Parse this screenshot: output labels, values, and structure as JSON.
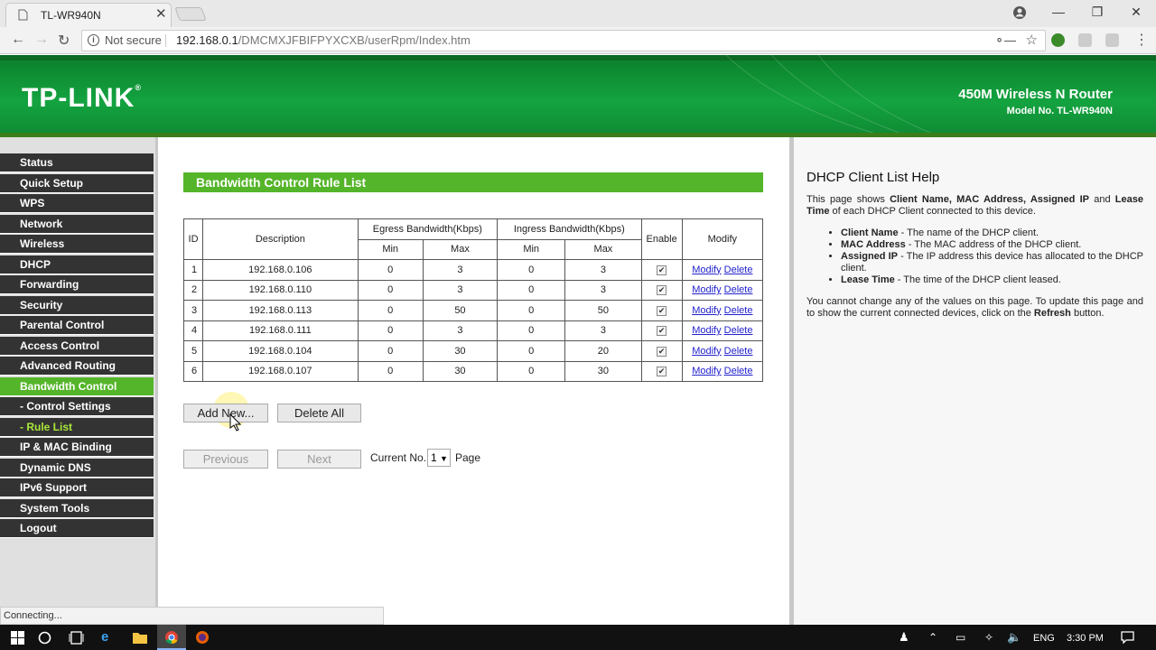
{
  "browser": {
    "tab_title": "TL-WR940N",
    "close_tab": "✕",
    "not_secure": "Not secure",
    "url_host": "192.168.0.1",
    "url_path": "/DMCMXJFBIFPYXCXB/userRpm/Index.htm",
    "status": "Connecting..."
  },
  "header": {
    "logo": "TP-LINK",
    "product": "450M Wireless N Router",
    "model": "Model No. TL-WR940N"
  },
  "sidebar": {
    "items": [
      {
        "label": "Status"
      },
      {
        "label": "Quick Setup"
      },
      {
        "label": "WPS"
      },
      {
        "label": "Network"
      },
      {
        "label": "Wireless"
      },
      {
        "label": "DHCP"
      },
      {
        "label": "Forwarding"
      },
      {
        "label": "Security"
      },
      {
        "label": "Parental Control"
      },
      {
        "label": "Access Control"
      },
      {
        "label": "Advanced Routing"
      },
      {
        "label": "Bandwidth Control"
      },
      {
        "label": "- Control Settings"
      },
      {
        "label": "- Rule List"
      },
      {
        "label": "IP & MAC Binding"
      },
      {
        "label": "Dynamic DNS"
      },
      {
        "label": "IPv6 Support"
      },
      {
        "label": "System Tools"
      },
      {
        "label": "Logout"
      }
    ]
  },
  "main": {
    "title": "Bandwidth Control Rule List",
    "headers": {
      "id": "ID",
      "description": "Description",
      "egress": "Egress Bandwidth(Kbps)",
      "ingress": "Ingress Bandwidth(Kbps)",
      "enable": "Enable",
      "modify": "Modify",
      "min": "Min",
      "max": "Max"
    },
    "rows": [
      {
        "id": "1",
        "desc": "192.168.0.106",
        "emin": "0",
        "emax": "3",
        "imin": "0",
        "imax": "3"
      },
      {
        "id": "2",
        "desc": "192.168.0.110",
        "emin": "0",
        "emax": "3",
        "imin": "0",
        "imax": "3"
      },
      {
        "id": "3",
        "desc": "192.168.0.113",
        "emin": "0",
        "emax": "50",
        "imin": "0",
        "imax": "50"
      },
      {
        "id": "4",
        "desc": "192.168.0.111",
        "emin": "0",
        "emax": "3",
        "imin": "0",
        "imax": "3"
      },
      {
        "id": "5",
        "desc": "192.168.0.104",
        "emin": "0",
        "emax": "30",
        "imin": "0",
        "imax": "20"
      },
      {
        "id": "6",
        "desc": "192.168.0.107",
        "emin": "0",
        "emax": "30",
        "imin": "0",
        "imax": "30"
      }
    ],
    "modify_link": "Modify",
    "delete_link": "Delete",
    "add_new": "Add New...",
    "delete_all": "Delete All",
    "previous": "Previous",
    "next": "Next",
    "current_no": "Current No.",
    "page_value": "1",
    "page": "Page"
  },
  "help": {
    "title": "DHCP Client List Help",
    "intro_1": "This page shows ",
    "intro_b1": "Client Name, MAC Address, Assigned IP",
    "intro_2": " and ",
    "intro_b2": "Lease Time",
    "intro_3": " of each DHCP Client connected to this device.",
    "items": [
      {
        "term": "Client Name",
        "desc": " - The name of the DHCP client."
      },
      {
        "term": "MAC Address",
        "desc": " - The MAC address of the DHCP client."
      },
      {
        "term": "Assigned IP",
        "desc": " - The IP address this device has allocated to the DHCP client."
      },
      {
        "term": "Lease Time",
        "desc": " - The time of the DHCP client leased."
      }
    ],
    "outro_1": "You cannot change any of the values on this page. To update this page and to show the current connected devices, click on the ",
    "outro_b": "Refresh",
    "outro_2": " button."
  },
  "taskbar": {
    "lang": "ENG",
    "time": "3:30 PM"
  }
}
